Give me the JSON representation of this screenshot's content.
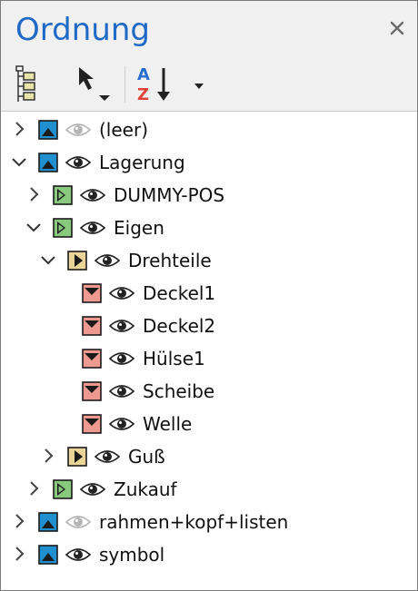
{
  "panel": {
    "title": "Ordnung",
    "close_glyph": "×"
  },
  "toolbar": {
    "buttons": [
      {
        "name": "tree-structure-icon"
      },
      {
        "name": "pointer-select-icon"
      },
      {
        "name": "sort-az-icon",
        "letter_a": "A",
        "letter_z": "Z"
      },
      {
        "name": "dropdown-arrow-icon"
      }
    ]
  },
  "colors": {
    "title": "#1e6ac6",
    "blue_layer": "#1f8fcf",
    "green_layer": "#88c97e",
    "yellow_layer": "#ead497",
    "red_layer": "#ee9a90"
  },
  "tree": {
    "items": [
      {
        "label": "(leer)",
        "expanded": false,
        "has_children": true,
        "icon": "blue",
        "eye_dim": true
      },
      {
        "label": "Lagerung",
        "expanded": true,
        "has_children": true,
        "icon": "blue",
        "eye_dim": false
      },
      {
        "label": "DUMMY-POS",
        "expanded": false,
        "has_children": true,
        "icon": "green",
        "eye_dim": false
      },
      {
        "label": "Eigen",
        "expanded": true,
        "has_children": true,
        "icon": "green",
        "eye_dim": false
      },
      {
        "label": "Drehteile",
        "expanded": true,
        "has_children": true,
        "icon": "yellow",
        "eye_dim": false
      },
      {
        "label": "Deckel1",
        "expanded": false,
        "has_children": false,
        "icon": "red",
        "eye_dim": false
      },
      {
        "label": "Deckel2",
        "expanded": false,
        "has_children": false,
        "icon": "red",
        "eye_dim": false
      },
      {
        "label": "Hülse1",
        "expanded": false,
        "has_children": false,
        "icon": "red",
        "eye_dim": false
      },
      {
        "label": "Scheibe",
        "expanded": false,
        "has_children": false,
        "icon": "red",
        "eye_dim": false
      },
      {
        "label": "Welle",
        "expanded": false,
        "has_children": false,
        "icon": "red",
        "eye_dim": false
      },
      {
        "label": "Guß",
        "expanded": false,
        "has_children": true,
        "icon": "yellow",
        "eye_dim": false
      },
      {
        "label": "Zukauf",
        "expanded": false,
        "has_children": true,
        "icon": "green",
        "eye_dim": false
      },
      {
        "label": "rahmen+kopf+listen",
        "expanded": false,
        "has_children": true,
        "icon": "blue",
        "eye_dim": true
      },
      {
        "label": "symbol",
        "expanded": false,
        "has_children": true,
        "icon": "blue",
        "eye_dim": false
      }
    ]
  }
}
